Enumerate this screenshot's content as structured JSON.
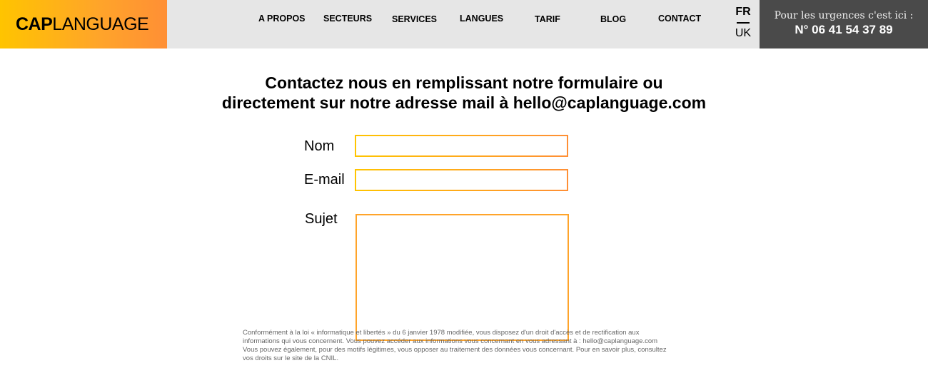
{
  "header": {
    "logo": {
      "bold": "CAP",
      "light": "LANGUAGE"
    },
    "nav": [
      {
        "label": "A PROPOS"
      },
      {
        "label": "SECTEURS"
      },
      {
        "label": "SERVICES"
      },
      {
        "label": "LANGUES"
      },
      {
        "label": "TARIF"
      },
      {
        "label": "BLOG"
      },
      {
        "label": "CONTACT"
      }
    ],
    "languages": {
      "active": "FR",
      "other": "UK"
    },
    "urgent": {
      "label": "Pour les urgences c'est ici :",
      "phone": "N° 06 41 54 37 89"
    }
  },
  "intro": {
    "line1": "Contactez nous en remplissant notre formulaire ou",
    "line2": "directement sur notre adresse mail à hello@caplanguage.com"
  },
  "form": {
    "name_label": "Nom",
    "name_value": "",
    "email_label": "E-mail",
    "email_value": "",
    "subject_label": "Sujet",
    "subject_value": ""
  },
  "legal": {
    "line1": "Conformément à la loi « informatique et libertés » du 6 janvier 1978 modifiée, vous disposez d'un droit d'accès et de rectification aux",
    "line2": "informations qui vous concernent. Vous pouvez accéder aux informations vous concernant en vous adressant à : hello@caplanguage.com",
    "line3": "Vous pouvez également, pour des motifs légitimes, vous opposer au traitement des données vous concernant. Pour en savoir plus, consultez",
    "line4": "vos droits sur le site de la CNIL."
  },
  "colors": {
    "logo_gradient_start": "#ffc400",
    "logo_gradient_end": "#ff8f35",
    "header_bg": "#e6e6e6",
    "urgent_bg": "#4a4a4a",
    "field_border": "#ffa42a"
  }
}
